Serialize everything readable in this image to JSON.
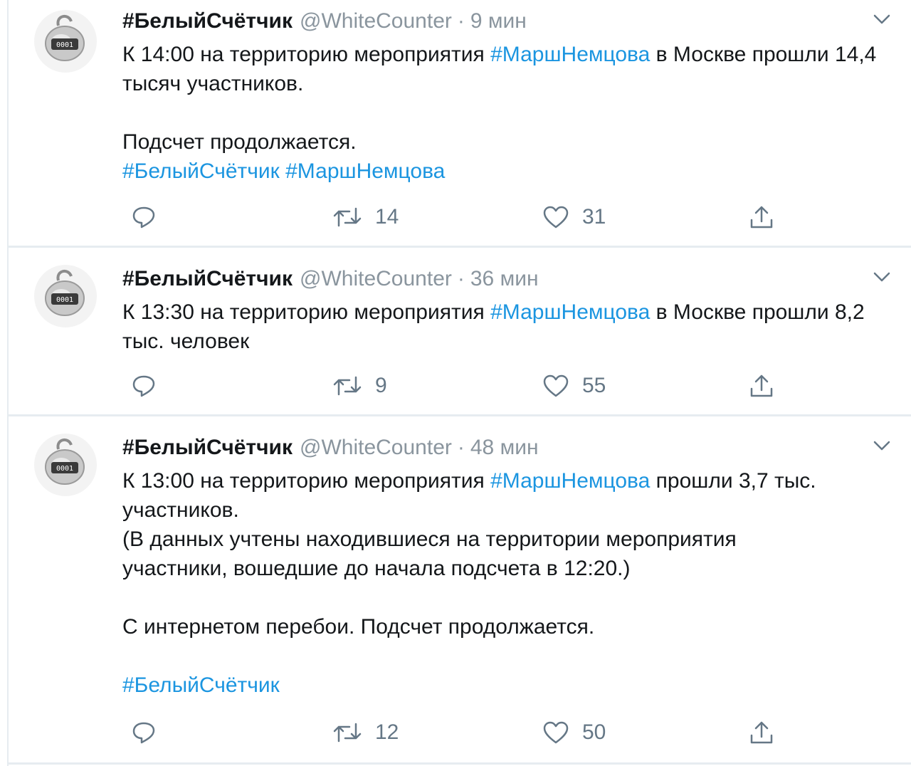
{
  "tweets": [
    {
      "name": "#БелыйСчётчик",
      "handle": "@WhiteCounter",
      "time": "9 мин",
      "text": {
        "line1_prefix": "К 14:00 на территорию мероприятия ",
        "line1_hashtag": "#МаршНемцова",
        "line1_suffix": " в Москве прошли 14,4 тысяч участников.",
        "line2": "Подсчет продолжается.",
        "hashtag_a": "#БелыйСчётчик",
        "hashtag_b": "#МаршНемцова"
      },
      "stats": {
        "retweets": "14",
        "likes": "31"
      }
    },
    {
      "name": "#БелыйСчётчик",
      "handle": "@WhiteCounter",
      "time": "36 мин",
      "text": {
        "line1_prefix": "К 13:30 на территорию мероприятия ",
        "line1_hashtag": "#МаршНемцова",
        "line1_suffix": " в Москве прошли 8,2 тыс. человек"
      },
      "stats": {
        "retweets": "9",
        "likes": "55"
      }
    },
    {
      "name": "#БелыйСчётчик",
      "handle": "@WhiteCounter",
      "time": "48 мин",
      "text": {
        "line1_prefix": "К 13:00 на территорию мероприятия ",
        "line1_hashtag": "#МаршНемцова",
        "line1_suffix": " прошли 3,7 тыс. участников.",
        "line2": "(В данных учтены находившиеся на территории мероприятия участники, вошедшие до начала подсчета в 12:20.)",
        "line3": "С интернетом перебои. Подсчет продолжается.",
        "hashtag_a": "#БелыйСчётчик"
      },
      "stats": {
        "retweets": "12",
        "likes": "50"
      }
    }
  ],
  "avatar_counter_digits": "0001",
  "icons": {
    "reply": "reply-icon",
    "retweet": "retweet-icon",
    "like": "heart-icon",
    "share": "share-icon",
    "menu": "chevron-down-icon"
  },
  "colors": {
    "link": "#1b95e0",
    "secondary": "#657786",
    "separator": "#e6ecf0"
  }
}
